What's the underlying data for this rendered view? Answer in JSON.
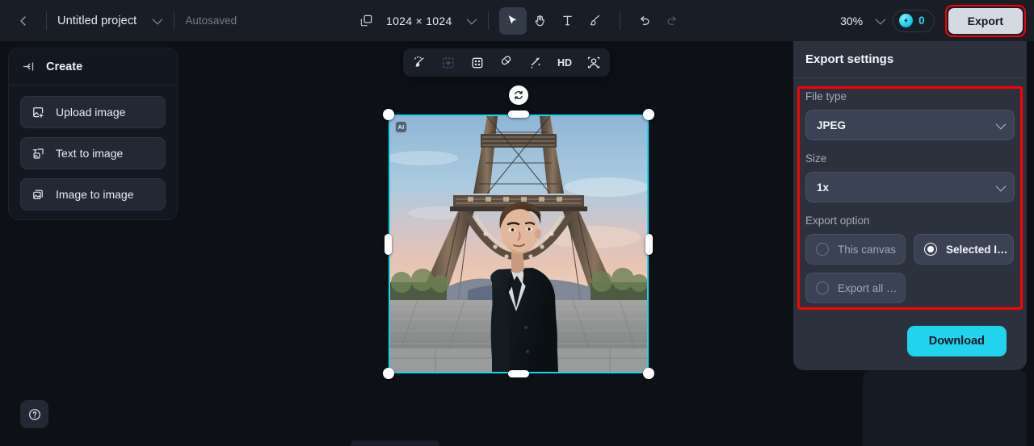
{
  "topbar": {
    "back_icon": "chevron-left-icon",
    "project_name": "Untitled project",
    "project_chevron": "chevron-down-icon",
    "autosaved": "Autosaved",
    "canvas_resize_icon": "canvas-resize-icon",
    "canvas_size": "1024 × 1024",
    "size_chevron": "chevron-down-icon",
    "tools": [
      {
        "name": "select-tool",
        "icon": "cursor-arrow-icon",
        "active": true
      },
      {
        "name": "pan-tool",
        "icon": "hand-icon",
        "active": false
      },
      {
        "name": "text-tool",
        "icon": "text-t-icon",
        "active": false
      },
      {
        "name": "brush-tool",
        "icon": "paintbrush-icon",
        "active": false
      },
      {
        "name": "undo-button",
        "icon": "undo-arrow-icon",
        "active": false
      },
      {
        "name": "redo-button",
        "icon": "redo-arrow-icon",
        "active": false
      }
    ],
    "zoom_level": "30%",
    "zoom_chevron": "chevron-down-icon",
    "credits_icon": "credit-bolt-icon",
    "credits_count": "0",
    "export_label": "Export"
  },
  "sidebar": {
    "collapse_icon": "collapse-panel-icon",
    "title": "Create",
    "items": [
      {
        "label": "Upload image",
        "icon": "image-plus-icon"
      },
      {
        "label": "Text to image",
        "icon": "text-to-image-icon"
      },
      {
        "label": "Image to image",
        "icon": "image-stack-icon"
      }
    ],
    "help_icon": "question-circle-icon"
  },
  "canvas_toolbar": {
    "items": [
      {
        "name": "inpaint-brush-tool",
        "icon": "magic-brush-icon",
        "label": "",
        "dim": false
      },
      {
        "name": "expand-canvas-tool",
        "icon": "expand-frame-icon",
        "label": "",
        "dim": true
      },
      {
        "name": "crop-tool",
        "icon": "crop-frame-icon",
        "label": "",
        "dim": false
      },
      {
        "name": "eraser-tool",
        "icon": "eraser-icon",
        "label": "",
        "dim": false
      },
      {
        "name": "magic-wand-tool",
        "icon": "magic-wand-icon",
        "label": "",
        "dim": false
      },
      {
        "name": "hd-upscale-tool",
        "icon": "hd-text-icon",
        "label": "HD",
        "dim": false
      },
      {
        "name": "face-enhance-tool",
        "icon": "face-enhance-icon",
        "label": "",
        "dim": false
      }
    ]
  },
  "canvas": {
    "ai_badge": "AI",
    "rotate_icon": "rotate-handle-icon",
    "selection_color": "#22d3ee",
    "image_description": "Man in dark suit standing in front of the Eiffel Tower at dusk"
  },
  "export_panel": {
    "title": "Export settings",
    "file_type_label": "File type",
    "file_type_value": "JPEG",
    "size_label": "Size",
    "size_value": "1x",
    "export_option_label": "Export option",
    "options": [
      {
        "label": "This canvas",
        "selected": false
      },
      {
        "label": "Selected I…",
        "selected": true
      },
      {
        "label": "Export all …",
        "selected": false
      }
    ],
    "download_label": "Download",
    "accent_color": "#22d3ee",
    "highlight_color": "#ff0000"
  }
}
